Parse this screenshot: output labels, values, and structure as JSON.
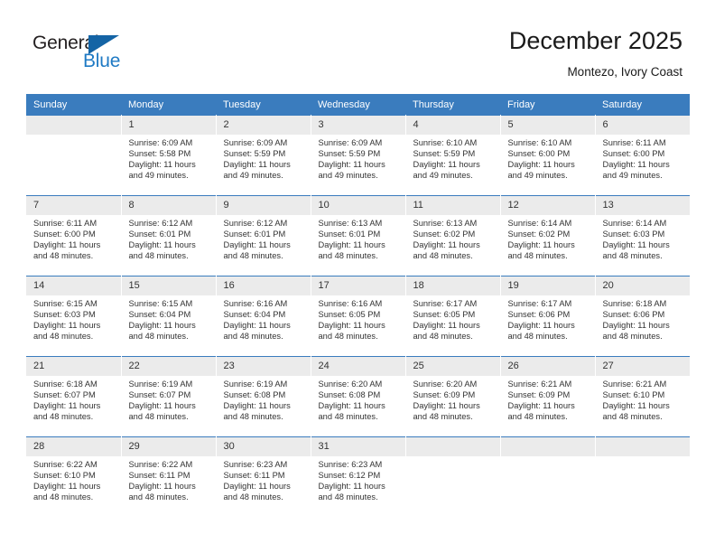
{
  "logo": {
    "word_top": "General",
    "word_bottom": "Blue",
    "accent_color": "#1464a5",
    "text_color": "#231f20"
  },
  "header": {
    "title": "December 2025",
    "subtitle": "Montezo, Ivory Coast"
  },
  "theme": {
    "header_bg": "#3a7cbe",
    "daynum_bg": "#ebebeb",
    "page_bg": "#ffffff"
  },
  "calendar": {
    "weekday_headers": [
      "Sunday",
      "Monday",
      "Tuesday",
      "Wednesday",
      "Thursday",
      "Friday",
      "Saturday"
    ],
    "weeks": [
      [
        {
          "day": "",
          "empty": true,
          "sunrise": "",
          "sunset": "",
          "daylight_1": "",
          "daylight_2": ""
        },
        {
          "day": "1",
          "sunrise": "Sunrise: 6:09 AM",
          "sunset": "Sunset: 5:58 PM",
          "daylight_1": "Daylight: 11 hours",
          "daylight_2": "and 49 minutes."
        },
        {
          "day": "2",
          "sunrise": "Sunrise: 6:09 AM",
          "sunset": "Sunset: 5:59 PM",
          "daylight_1": "Daylight: 11 hours",
          "daylight_2": "and 49 minutes."
        },
        {
          "day": "3",
          "sunrise": "Sunrise: 6:09 AM",
          "sunset": "Sunset: 5:59 PM",
          "daylight_1": "Daylight: 11 hours",
          "daylight_2": "and 49 minutes."
        },
        {
          "day": "4",
          "sunrise": "Sunrise: 6:10 AM",
          "sunset": "Sunset: 5:59 PM",
          "daylight_1": "Daylight: 11 hours",
          "daylight_2": "and 49 minutes."
        },
        {
          "day": "5",
          "sunrise": "Sunrise: 6:10 AM",
          "sunset": "Sunset: 6:00 PM",
          "daylight_1": "Daylight: 11 hours",
          "daylight_2": "and 49 minutes."
        },
        {
          "day": "6",
          "sunrise": "Sunrise: 6:11 AM",
          "sunset": "Sunset: 6:00 PM",
          "daylight_1": "Daylight: 11 hours",
          "daylight_2": "and 49 minutes."
        }
      ],
      [
        {
          "day": "7",
          "sunrise": "Sunrise: 6:11 AM",
          "sunset": "Sunset: 6:00 PM",
          "daylight_1": "Daylight: 11 hours",
          "daylight_2": "and 48 minutes."
        },
        {
          "day": "8",
          "sunrise": "Sunrise: 6:12 AM",
          "sunset": "Sunset: 6:01 PM",
          "daylight_1": "Daylight: 11 hours",
          "daylight_2": "and 48 minutes."
        },
        {
          "day": "9",
          "sunrise": "Sunrise: 6:12 AM",
          "sunset": "Sunset: 6:01 PM",
          "daylight_1": "Daylight: 11 hours",
          "daylight_2": "and 48 minutes."
        },
        {
          "day": "10",
          "sunrise": "Sunrise: 6:13 AM",
          "sunset": "Sunset: 6:01 PM",
          "daylight_1": "Daylight: 11 hours",
          "daylight_2": "and 48 minutes."
        },
        {
          "day": "11",
          "sunrise": "Sunrise: 6:13 AM",
          "sunset": "Sunset: 6:02 PM",
          "daylight_1": "Daylight: 11 hours",
          "daylight_2": "and 48 minutes."
        },
        {
          "day": "12",
          "sunrise": "Sunrise: 6:14 AM",
          "sunset": "Sunset: 6:02 PM",
          "daylight_1": "Daylight: 11 hours",
          "daylight_2": "and 48 minutes."
        },
        {
          "day": "13",
          "sunrise": "Sunrise: 6:14 AM",
          "sunset": "Sunset: 6:03 PM",
          "daylight_1": "Daylight: 11 hours",
          "daylight_2": "and 48 minutes."
        }
      ],
      [
        {
          "day": "14",
          "sunrise": "Sunrise: 6:15 AM",
          "sunset": "Sunset: 6:03 PM",
          "daylight_1": "Daylight: 11 hours",
          "daylight_2": "and 48 minutes."
        },
        {
          "day": "15",
          "sunrise": "Sunrise: 6:15 AM",
          "sunset": "Sunset: 6:04 PM",
          "daylight_1": "Daylight: 11 hours",
          "daylight_2": "and 48 minutes."
        },
        {
          "day": "16",
          "sunrise": "Sunrise: 6:16 AM",
          "sunset": "Sunset: 6:04 PM",
          "daylight_1": "Daylight: 11 hours",
          "daylight_2": "and 48 minutes."
        },
        {
          "day": "17",
          "sunrise": "Sunrise: 6:16 AM",
          "sunset": "Sunset: 6:05 PM",
          "daylight_1": "Daylight: 11 hours",
          "daylight_2": "and 48 minutes."
        },
        {
          "day": "18",
          "sunrise": "Sunrise: 6:17 AM",
          "sunset": "Sunset: 6:05 PM",
          "daylight_1": "Daylight: 11 hours",
          "daylight_2": "and 48 minutes."
        },
        {
          "day": "19",
          "sunrise": "Sunrise: 6:17 AM",
          "sunset": "Sunset: 6:06 PM",
          "daylight_1": "Daylight: 11 hours",
          "daylight_2": "and 48 minutes."
        },
        {
          "day": "20",
          "sunrise": "Sunrise: 6:18 AM",
          "sunset": "Sunset: 6:06 PM",
          "daylight_1": "Daylight: 11 hours",
          "daylight_2": "and 48 minutes."
        }
      ],
      [
        {
          "day": "21",
          "sunrise": "Sunrise: 6:18 AM",
          "sunset": "Sunset: 6:07 PM",
          "daylight_1": "Daylight: 11 hours",
          "daylight_2": "and 48 minutes."
        },
        {
          "day": "22",
          "sunrise": "Sunrise: 6:19 AM",
          "sunset": "Sunset: 6:07 PM",
          "daylight_1": "Daylight: 11 hours",
          "daylight_2": "and 48 minutes."
        },
        {
          "day": "23",
          "sunrise": "Sunrise: 6:19 AM",
          "sunset": "Sunset: 6:08 PM",
          "daylight_1": "Daylight: 11 hours",
          "daylight_2": "and 48 minutes."
        },
        {
          "day": "24",
          "sunrise": "Sunrise: 6:20 AM",
          "sunset": "Sunset: 6:08 PM",
          "daylight_1": "Daylight: 11 hours",
          "daylight_2": "and 48 minutes."
        },
        {
          "day": "25",
          "sunrise": "Sunrise: 6:20 AM",
          "sunset": "Sunset: 6:09 PM",
          "daylight_1": "Daylight: 11 hours",
          "daylight_2": "and 48 minutes."
        },
        {
          "day": "26",
          "sunrise": "Sunrise: 6:21 AM",
          "sunset": "Sunset: 6:09 PM",
          "daylight_1": "Daylight: 11 hours",
          "daylight_2": "and 48 minutes."
        },
        {
          "day": "27",
          "sunrise": "Sunrise: 6:21 AM",
          "sunset": "Sunset: 6:10 PM",
          "daylight_1": "Daylight: 11 hours",
          "daylight_2": "and 48 minutes."
        }
      ],
      [
        {
          "day": "28",
          "sunrise": "Sunrise: 6:22 AM",
          "sunset": "Sunset: 6:10 PM",
          "daylight_1": "Daylight: 11 hours",
          "daylight_2": "and 48 minutes."
        },
        {
          "day": "29",
          "sunrise": "Sunrise: 6:22 AM",
          "sunset": "Sunset: 6:11 PM",
          "daylight_1": "Daylight: 11 hours",
          "daylight_2": "and 48 minutes."
        },
        {
          "day": "30",
          "sunrise": "Sunrise: 6:23 AM",
          "sunset": "Sunset: 6:11 PM",
          "daylight_1": "Daylight: 11 hours",
          "daylight_2": "and 48 minutes."
        },
        {
          "day": "31",
          "sunrise": "Sunrise: 6:23 AM",
          "sunset": "Sunset: 6:12 PM",
          "daylight_1": "Daylight: 11 hours",
          "daylight_2": "and 48 minutes."
        },
        {
          "day": "",
          "empty": true,
          "sunrise": "",
          "sunset": "",
          "daylight_1": "",
          "daylight_2": ""
        },
        {
          "day": "",
          "empty": true,
          "sunrise": "",
          "sunset": "",
          "daylight_1": "",
          "daylight_2": ""
        },
        {
          "day": "",
          "empty": true,
          "sunrise": "",
          "sunset": "",
          "daylight_1": "",
          "daylight_2": ""
        }
      ]
    ]
  }
}
